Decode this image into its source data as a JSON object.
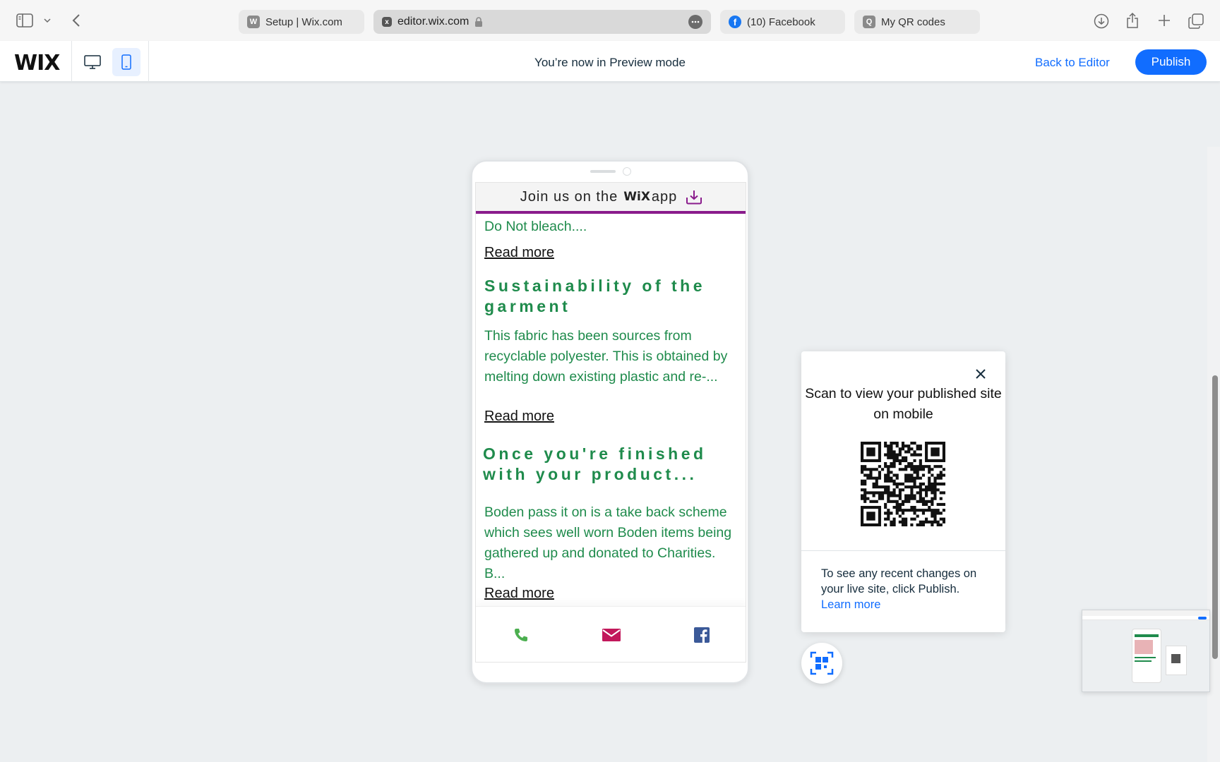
{
  "browser": {
    "tabs": [
      {
        "title": "Setup | Wix.com",
        "favicon": "W"
      },
      {
        "title": "editor.wix.com",
        "favicon": "x"
      },
      {
        "title": "(10) Facebook",
        "favicon": "f"
      },
      {
        "title": "My QR codes",
        "favicon": "Q"
      }
    ]
  },
  "wix_bar": {
    "logo": "WIX",
    "preview_text": "You’re now in Preview mode",
    "back_to_editor": "Back to Editor",
    "publish": "Publish"
  },
  "phone": {
    "banner": {
      "prefix": "Join us on the",
      "brand": "WiX",
      "suffix": "app"
    },
    "intro_text": "Do Not bleach....",
    "read_more": "Read more",
    "sections": [
      {
        "heading": "Sustainability of the garment",
        "body": "This fabric has been sources from recyclable polyester. This is obtained by melting down existing plastic and re-..."
      },
      {
        "heading": "Once you're finished with your product...",
        "body": "Boden pass it on is a take back scheme which sees well worn Boden items being gathered up and donated to Charities. B..."
      }
    ],
    "actions": [
      "phone-icon",
      "email-icon",
      "facebook-icon"
    ]
  },
  "qr_panel": {
    "title": "Scan to view your published site on mobile",
    "note": "To see any recent changes on your live site, click Publish.",
    "learn_more": "Learn more"
  },
  "colors": {
    "accent": "#116dff",
    "text_green": "#1f8b4c",
    "banner_underline": "#8a1c8c",
    "email_icon": "#c2185b",
    "phone_icon": "#4caf50",
    "facebook_icon": "#3b5998"
  }
}
